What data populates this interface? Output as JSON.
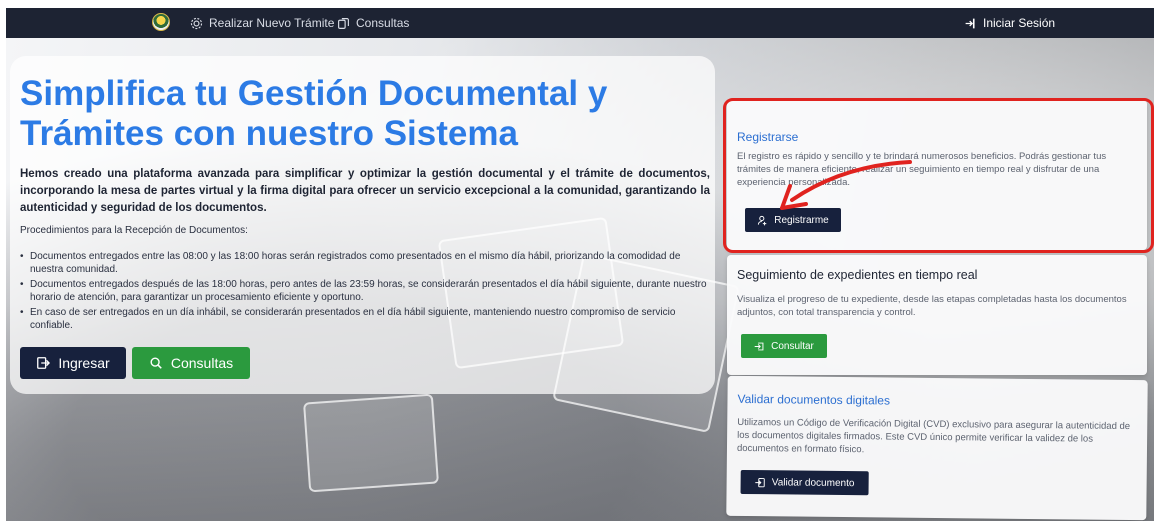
{
  "nav": {
    "new_procedure": "Realizar Nuevo Trámite",
    "queries": "Consultas",
    "login": "Iniciar Sesión"
  },
  "hero": {
    "title": "Simplifica tu Gestión Documental y Trámites con nuestro Sistema",
    "description": "Hemos creado una plataforma avanzada para simplificar y optimizar la gestión documental y el trámite de documentos, incorporando la mesa de partes virtual y la firma digital para ofrecer un servicio excepcional a la comunidad, garantizando la autenticidad y seguridad de los documentos.",
    "procedures_title": "Procedimientos para la Recepción de Documentos:",
    "procedures": [
      "Documentos entregados entre las 08:00 y las 18:00 horas serán registrados como presentados en el mismo día hábil, priorizando la comodidad de nuestra comunidad.",
      "Documentos entregados después de las 18:00 horas, pero antes de las 23:59 horas, se considerarán presentados el día hábil siguiente, durante nuestro horario de atención, para garantizar un procesamiento eficiente y oportuno.",
      "En caso de ser entregados en un día inhábil, se considerarán presentados en el día hábil siguiente, manteniendo nuestro compromiso de servicio confiable."
    ],
    "btn_login": "Ingresar",
    "btn_queries": "Consultas"
  },
  "cards": {
    "register": {
      "title": "Registrarse",
      "text": "El registro es rápido y sencillo y te brindará numerosos beneficios. Podrás gestionar tus trámites de manera eficiente, realizar un seguimiento en tiempo real y disfrutar de una experiencia personalizada.",
      "button": "Registrarme"
    },
    "tracking": {
      "title": "Seguimiento de expedientes en tiempo real",
      "text": "Visualiza el progreso de tu expediente, desde las etapas completadas hasta los documentos adjuntos, con total transparencia y control.",
      "button": "Consultar"
    },
    "validate": {
      "title": "Validar documentos digitales",
      "text": "Utilizamos un Código de Verificación Digital (CVD) exclusivo para asegurar la autenticidad de los documentos digitales firmados. Este CVD único permite verificar la validez de los documentos en formato físico.",
      "button": "Validar documento"
    }
  },
  "colors": {
    "navbar": "#1d2333",
    "title_blue": "#2c7be5",
    "btn_dark": "#17213d",
    "btn_green": "#2b9a3e",
    "highlight_red": "#e0231f"
  }
}
